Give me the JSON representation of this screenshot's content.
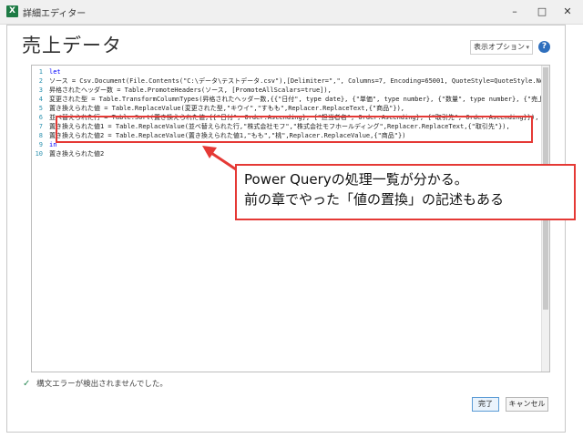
{
  "window": {
    "app_icon_letter": "X",
    "title": "詳細エディター",
    "minimize": "–",
    "maximize": "□",
    "close": "✕"
  },
  "page": {
    "title": "売上データ",
    "display_options": "表示オプション",
    "help": "?"
  },
  "editor": {
    "lines": [
      {
        "n": "1",
        "text": "let"
      },
      {
        "n": "2",
        "text": "    ソース = Csv.Document(File.Contents(\"C:\\データ\\テストデータ.csv\"),[Delimiter=\",\", Columns=7, Encoding=65001, QuoteStyle=QuoteStyle.None]),"
      },
      {
        "n": "3",
        "text": "    昇格されたヘッダー数 = Table.PromoteHeaders(ソース, [PromoteAllScalars=true]),"
      },
      {
        "n": "4",
        "text": "    変更された型 = Table.TransformColumnTypes(昇格されたヘッダー数,{{\"日付\", type date}, {\"単価\", type number}, {\"数量\", type number}, {\"売上\","
      },
      {
        "n": "5",
        "text": "    置き換えられた値 = Table.ReplaceValue(変更された型,\"キウイ\",\"すもも\",Replacer.ReplaceText,{\"商品\"}),"
      },
      {
        "n": "6",
        "text": "    並べ替えられた行 = Table.Sort(置き換えられた値,{{\"日付\", Order.Ascending}, {\"担当者名\", Order.Ascending}, {\"取引先\", Order.Ascending}}),"
      },
      {
        "n": "7",
        "text": "    置き換えられた値1 = Table.ReplaceValue(並べ替えられた行,\"株式会社モフ\",\"株式会社モフホールディング\",Replacer.ReplaceText,{\"取引先\"}),"
      },
      {
        "n": "8",
        "text": "    置き換えられた値2 = Table.ReplaceValue(置き換えられた値1,\"もも\",\"桃\",Replacer.ReplaceValue,{\"商品\"})"
      },
      {
        "n": "9",
        "text": "in"
      },
      {
        "n": "10",
        "text": "    置き換えられた値2"
      }
    ]
  },
  "callout": {
    "line1": "Power Queryの処理一覧が分かる。",
    "line2": "前の章でやった「値の置換」の記述もある"
  },
  "status": {
    "text": "構文エラーが検出されませんでした。"
  },
  "buttons": {
    "done": "完了",
    "cancel": "キャンセル"
  },
  "colors": {
    "highlight": "#e53935",
    "keyword": "#0000ff",
    "line_number": "#2b91af"
  }
}
